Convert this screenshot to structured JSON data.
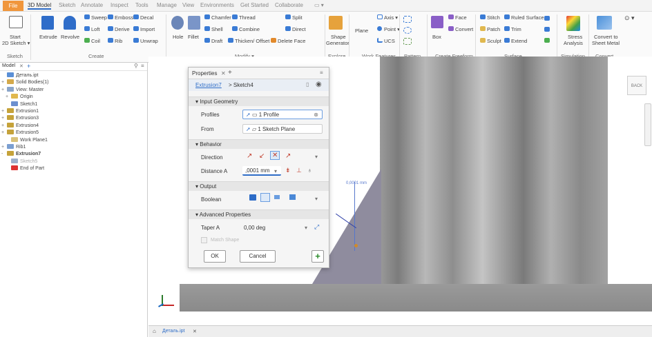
{
  "tabs": {
    "file": "File",
    "items": [
      "3D Model",
      "Sketch",
      "Annotate",
      "Inspect",
      "Tools",
      "Manage",
      "View",
      "Environments",
      "Get Started",
      "Collaborate"
    ],
    "extra": "▭ ▾"
  },
  "ribbon": {
    "sketch": {
      "start": "Start",
      "sketch2d": "2D Sketch ▾",
      "group": "Sketch"
    },
    "create": {
      "extrude": "Extrude",
      "revolve": "Revolve",
      "sweep": "Sweep",
      "emboss": "Emboss",
      "decal": "Decal",
      "loft": "Loft",
      "derive": "Derive",
      "import": "Import",
      "coil": "Coil",
      "rib": "Rib",
      "unwrap": "Unwrap",
      "group": "Create"
    },
    "modify": {
      "hole": "Hole",
      "fillet": "Fillet",
      "chamfer": "Chamfer",
      "thread": "Thread",
      "split": "Split",
      "shell": "Shell",
      "combine": "Combine",
      "direct": "Direct",
      "draft": "Draft",
      "thicken": "Thicken/ Offset",
      "delete_face": "Delete Face",
      "group": "Modify ▾"
    },
    "explore": {
      "shape_gen": "Shape",
      "shape_gen2": "Generator",
      "group": "Explore"
    },
    "work": {
      "plane": "Plane",
      "axis": "Axis ▾",
      "point": "Point ▾",
      "ucs": "UCS",
      "group": "Work Features"
    },
    "pattern": {
      "group": "Pattern"
    },
    "freeform": {
      "box": "Box",
      "face": "Face",
      "convert": "Convert",
      "group": "Create Freeform"
    },
    "surface": {
      "stitch": "Stitch",
      "ruled": "Ruled Surface",
      "patch": "Patch",
      "trim": "Trim",
      "sculpt": "Sculpt",
      "extend": "Extend",
      "group": "Surface"
    },
    "simulation": {
      "stress": "Stress",
      "analysis": "Analysis",
      "group": "Simulation"
    },
    "convert": {
      "to": "Convert to",
      "sheet": "Sheet Metal",
      "group": "Convert"
    }
  },
  "browser": {
    "tab": "Model",
    "items": [
      {
        "label": "Деталь.ipt",
        "pm": "",
        "color": "#5a8fd6"
      },
      {
        "label": "Solid Bodies(1)",
        "pm": "+",
        "color": "#d4a94a"
      },
      {
        "label": "View: Master",
        "pm": "+",
        "color": "#8aa5c9"
      },
      {
        "label": "Origin",
        "pm": "+",
        "color": "#e0b84e"
      },
      {
        "label": "Sketch1",
        "pm": "",
        "color": "#6c8fcf"
      },
      {
        "label": "Extrusion1",
        "pm": "+",
        "color": "#c5a23a"
      },
      {
        "label": "Extrusion3",
        "pm": "+",
        "color": "#c5a23a"
      },
      {
        "label": "Extrusion4",
        "pm": "+",
        "color": "#c5a23a"
      },
      {
        "label": "Extrusion5",
        "pm": "+",
        "color": "#c5a23a"
      },
      {
        "label": "Work Plane1",
        "pm": "",
        "color": "#d9c27a"
      },
      {
        "label": "Rib1",
        "pm": "+",
        "color": "#7b9fd1"
      },
      {
        "label": "Extrusion7",
        "pm": "-",
        "color": "#c5a23a"
      },
      {
        "label": "Sketch5",
        "pm": "",
        "color": "#9db0cc"
      },
      {
        "label": "End of Part",
        "pm": "",
        "color": "#d33"
      }
    ]
  },
  "panel": {
    "tab": "Properties",
    "breadcrumb_link": "Extrusion7",
    "breadcrumb_rest": "> Sketch4",
    "input_geometry": "Input Geometry",
    "profiles_label": "Profiles",
    "profiles_value": "1 Profile",
    "from_label": "From",
    "from_value": "1 Sketch Plane",
    "behavior": "Behavior",
    "direction_label": "Direction",
    "distance_label": "Distance A",
    "distance_value": ",0001 mm",
    "output": "Output",
    "boolean_label": "Boolean",
    "advanced": "Advanced Properties",
    "taper_label": "Taper A",
    "taper_value": "0,00 deg",
    "match_shape": "Match Shape",
    "ok": "OK",
    "cancel": "Cancel"
  },
  "viewport": {
    "dimension": "0,0001 mm",
    "viewcube": "BACK"
  },
  "docbar": {
    "tab": "Деталь.ipt"
  }
}
